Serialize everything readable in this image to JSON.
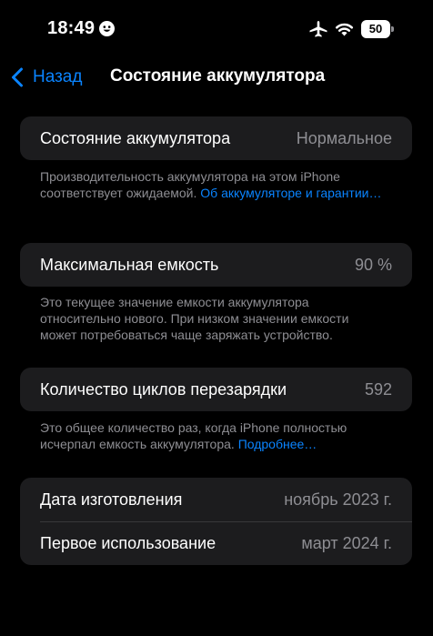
{
  "status_bar": {
    "time": "18:49",
    "battery_level": "50"
  },
  "nav": {
    "back_label": "Назад",
    "title": "Состояние аккумулятора"
  },
  "health": {
    "label": "Состояние аккумулятора",
    "value": "Нормальное",
    "footnote": "Производительность аккумулятора на этом iPhone соответствует ожидаемой.",
    "link": "Об аккумуляторе и гарантии…"
  },
  "capacity": {
    "label": "Максимальная емкость",
    "value": "90 %",
    "footnote": "Это текущее значение емкости аккумулятора относительно нового. При низком значении емкости может потребоваться чаще заряжать устройство."
  },
  "cycles": {
    "label": "Количество циклов перезарядки",
    "value": "592",
    "footnote": "Это общее количество раз, когда iPhone полностью исчерпал емкость аккумулятора.",
    "link": "Подробнее…"
  },
  "dates": {
    "manufacture_label": "Дата изготовления",
    "manufacture_value": "ноябрь 2023 г.",
    "first_use_label": "Первое использование",
    "first_use_value": "март 2024 г."
  },
  "colors": {
    "background": "#000000",
    "group_background": "#1c1c1e",
    "accent": "#0a84ff",
    "secondary_text": "#8e8e93"
  },
  "icons": {
    "status": [
      "focus-face-icon",
      "airplane-icon",
      "wifi-icon",
      "battery-icon"
    ],
    "nav": [
      "chevron-left-icon"
    ]
  }
}
